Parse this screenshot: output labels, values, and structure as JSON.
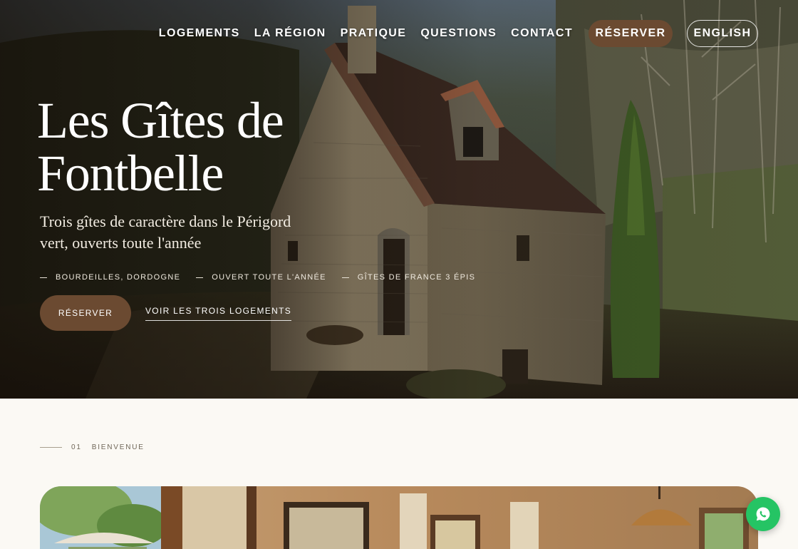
{
  "nav": {
    "links": [
      "LOGEMENTS",
      "LA RÉGION",
      "PRATIQUE",
      "QUESTIONS",
      "CONTACT"
    ],
    "reserve_label": "RÉSERVER",
    "language_label": "ENGLISH"
  },
  "hero": {
    "title": "Les Gîtes de Fontbelle",
    "subtitle": "Trois gîtes de caractère dans le Périgord vert, ouverts toute l'année",
    "tags": [
      "BOURDEILLES, DORDOGNE",
      "OUVERT TOUTE L'ANNÉE",
      "GÎTES DE FRANCE 3 ÉPIS"
    ],
    "cta_primary": "RÉSERVER",
    "cta_secondary": "VOIR LES TROIS LOGEMENTS"
  },
  "section": {
    "number": "01",
    "label": "BIENVENUE"
  },
  "colors": {
    "accent_brown": "#6b4a31",
    "background_cream": "#fbf9f4",
    "whatsapp_green": "#25c464"
  },
  "icons": {
    "chat": "whatsapp-icon"
  }
}
